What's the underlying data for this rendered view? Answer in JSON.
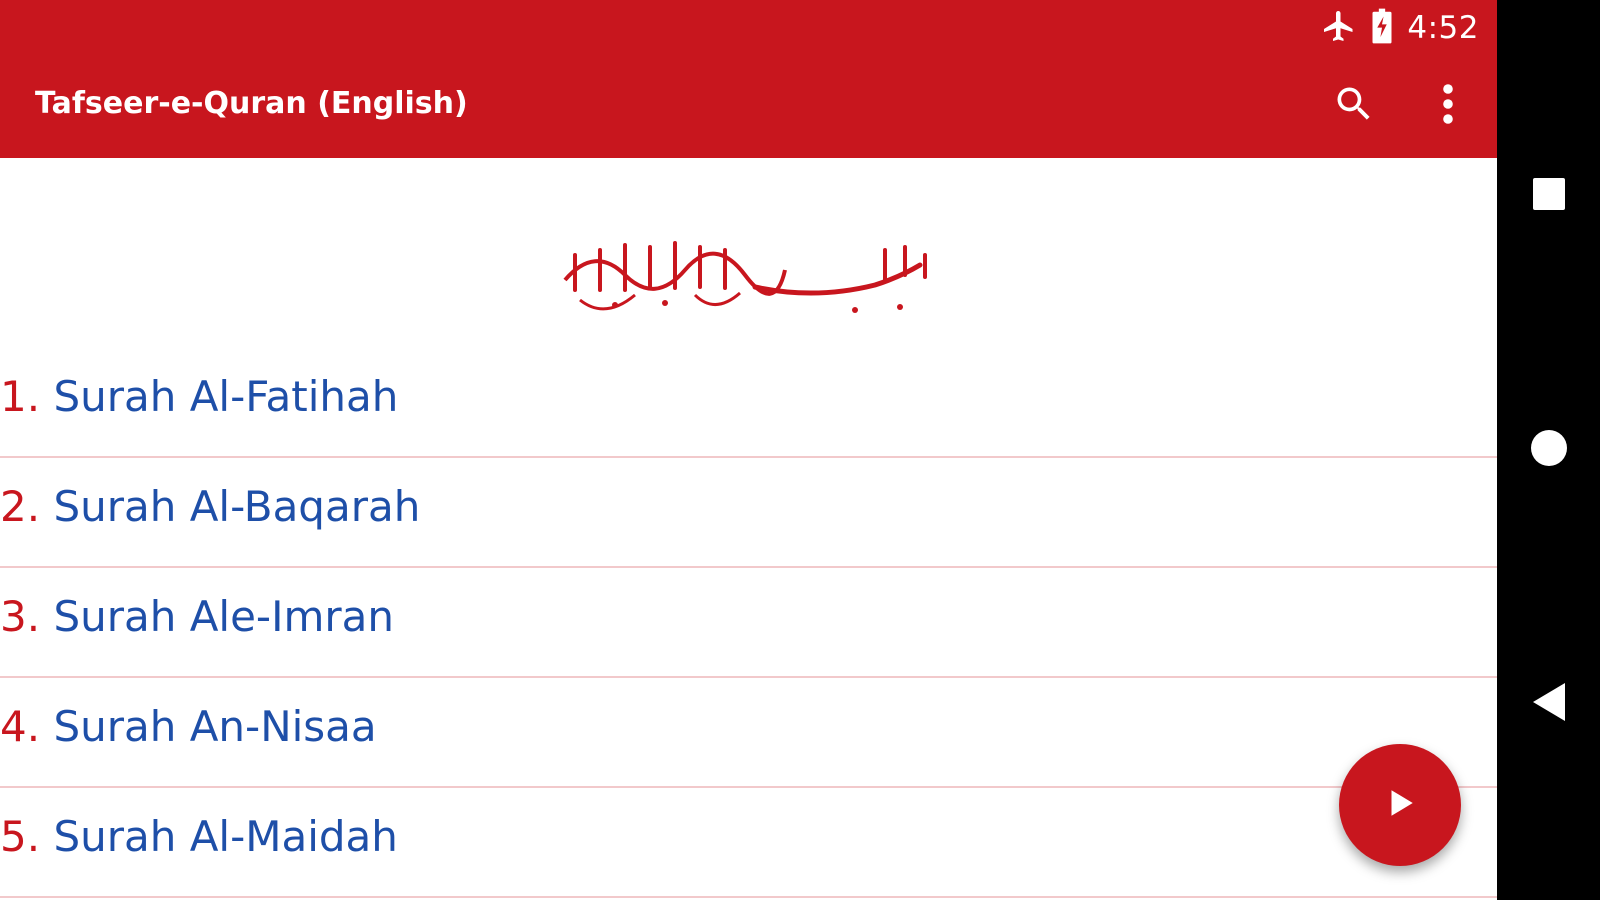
{
  "status_bar": {
    "time": "4:52",
    "icons": [
      "airplane-icon",
      "battery-charging-icon"
    ]
  },
  "toolbar": {
    "title": "Tafseer-e-Quran (English)",
    "actions": [
      "search-icon",
      "more-vert-icon"
    ]
  },
  "header": {
    "calligraphy": "بِسْمِ ٱللَّٰهِ ٱلرَّحْمَٰنِ ٱلرَّحِيمِ"
  },
  "surahs": [
    {
      "number": "1.",
      "name": "Surah Al-Fatihah"
    },
    {
      "number": "2.",
      "name": "Surah Al-Baqarah"
    },
    {
      "number": "3.",
      "name": "Surah Ale-Imran"
    },
    {
      "number": "4.",
      "name": "Surah An-Nisaa"
    },
    {
      "number": "5.",
      "name": "Surah Al-Maidah"
    }
  ],
  "fab": {
    "icon": "play-icon"
  },
  "nav_bar": {
    "buttons": [
      "recents-square-icon",
      "home-circle-icon",
      "back-triangle-icon"
    ]
  },
  "colors": {
    "primary": "#c8161e",
    "item_text": "#1e4fa8",
    "divider": "#f2c9cb"
  }
}
